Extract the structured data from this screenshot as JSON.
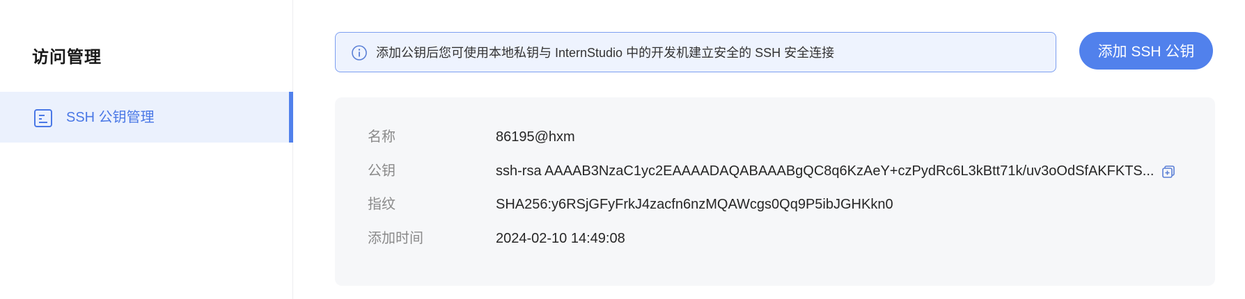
{
  "sidebar": {
    "title": "访问管理",
    "items": [
      {
        "label": "SSH 公钥管理",
        "icon": "document-list-icon",
        "active": true
      }
    ]
  },
  "banner": {
    "icon": "info-icon",
    "text": "添加公钥后您可使用本地私钥与 InternStudio 中的开发机建立安全的 SSH 安全连接"
  },
  "actions": {
    "add_label": "添加 SSH 公钥"
  },
  "key": {
    "name_label": "名称",
    "name_value": "86195@hxm",
    "key_label": "公钥",
    "key_value": "ssh-rsa AAAAB3NzaC1yc2EAAAADAQABAAABgQC8q6KzAeY+czPydRc6L3kBtt71k/uv3oOdSfAKFKTS...",
    "fingerprint_label": "指纹",
    "fingerprint_value": "SHA256:y6RSjGFyFrkJ4zacfn6nzMQAWcgs0Qq9P5ibJGHKkn0",
    "time_label": "添加时间",
    "time_value": "2024-02-10 14:49:08",
    "copy_icon": "copy-icon"
  },
  "colors": {
    "accent": "#5181ec",
    "sidebar_active_bg": "#ebf1fd",
    "banner_bg": "#eef3fe",
    "banner_border": "#7c9ef0",
    "card_bg": "#f6f7f9"
  }
}
